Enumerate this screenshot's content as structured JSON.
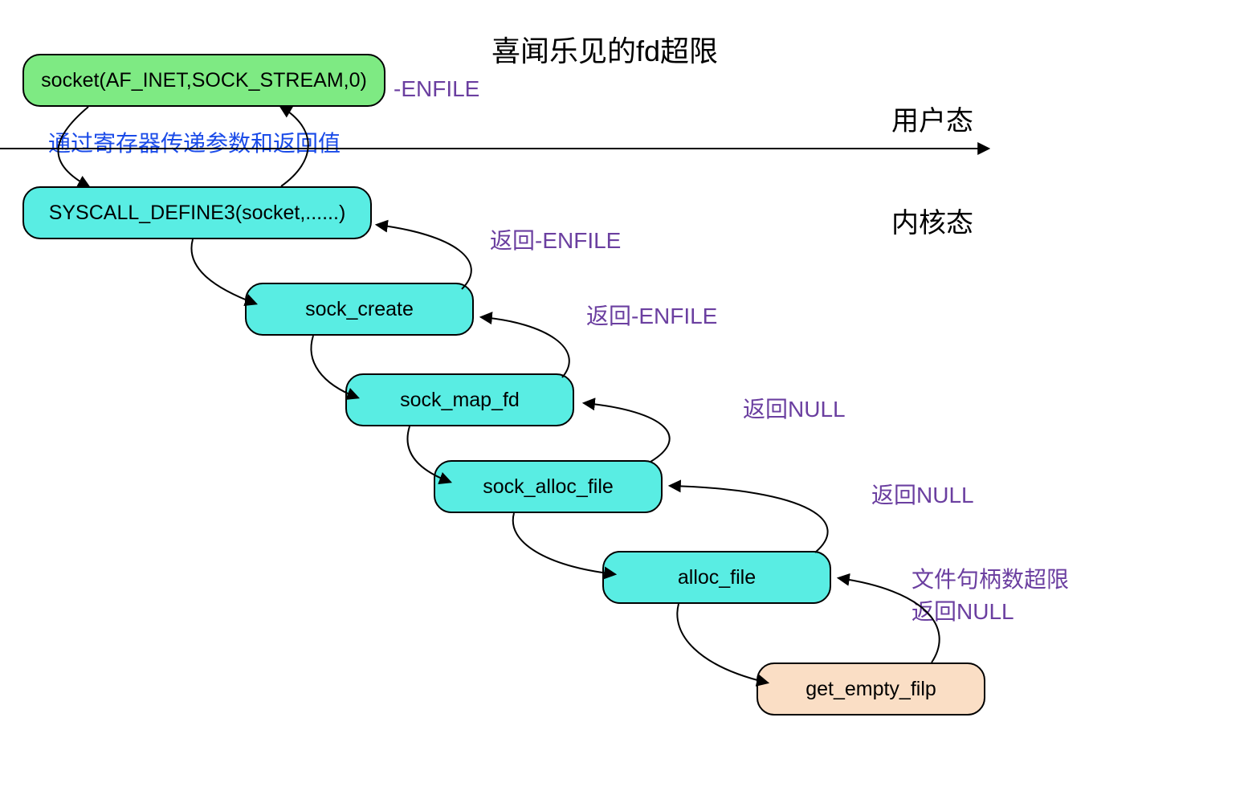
{
  "title": "喜闻乐见的fd超限",
  "sections": {
    "userspace": "用户态",
    "kernelspace": "内核态"
  },
  "nodes": {
    "socket_call": "socket(AF_INET,SOCK_STREAM,0)",
    "syscall_define": "SYSCALL_DEFINE3(socket,......)",
    "sock_create": "sock_create",
    "sock_map_fd": "sock_map_fd",
    "sock_alloc_file": "sock_alloc_file",
    "alloc_file": "alloc_file",
    "get_empty_filp": "get_empty_filp"
  },
  "labels": {
    "enfile": "-ENFILE",
    "register_pass": "通过寄存器传递参数和返回值",
    "return_enfile_1": "返回-ENFILE",
    "return_enfile_2": "返回-ENFILE",
    "return_null_1": "返回NULL",
    "return_null_2": "返回NULL",
    "file_limit_line1": "文件句柄数超限",
    "file_limit_line2": "返回NULL"
  }
}
